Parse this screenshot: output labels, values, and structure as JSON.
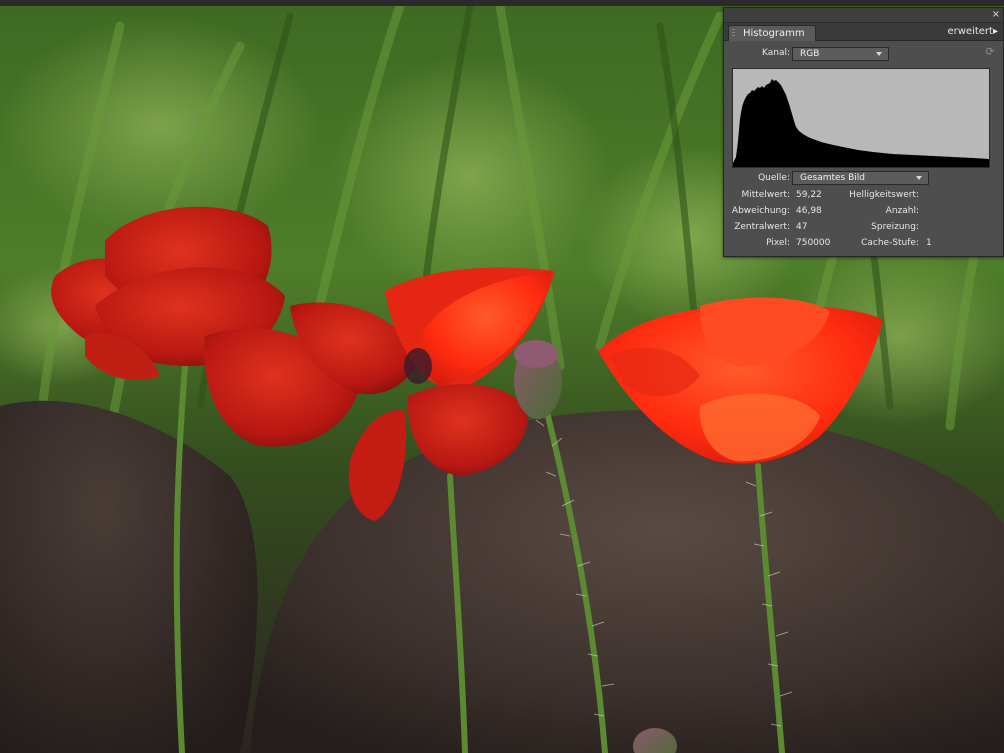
{
  "photo": {
    "description_icon": "poppy-photo",
    "colors": {
      "petal_main": "#ff2a10",
      "petal_dark": "#b51410",
      "stem": "#5b8a33",
      "foliage": "#4f7d2a",
      "rock": "#4a3a34"
    }
  },
  "panel": {
    "close_icon": "×",
    "tab": "Histogramm",
    "extended": "erweitert",
    "extended_arrow": "▸",
    "kanal_label": "Kanal:",
    "kanal_value": "RGB",
    "refresh_icon": "⟳",
    "quelle_label": "Quelle:",
    "quelle_value": "Gesamtes Bild",
    "stats": {
      "mittelwert_label": "Mittelwert:",
      "mittelwert_value": "59,22",
      "abweichung_label": "Abweichung:",
      "abweichung_value": "46,98",
      "zentralwert_label": "Zentralwert:",
      "zentralwert_value": "47",
      "pixel_label": "Pixel:",
      "pixel_value": "750000",
      "helligkeitswert_label": "Helligkeitswert:",
      "anzahl_label": "Anzahl:",
      "spreizung_label": "Spreizung:",
      "cache_label": "Cache-Stufe:",
      "cache_value": "1"
    },
    "colors": {
      "panel_bg": "#4e4e4e",
      "histogram_bg": "#b8b8b8",
      "histogram_fill": "#000000"
    }
  }
}
